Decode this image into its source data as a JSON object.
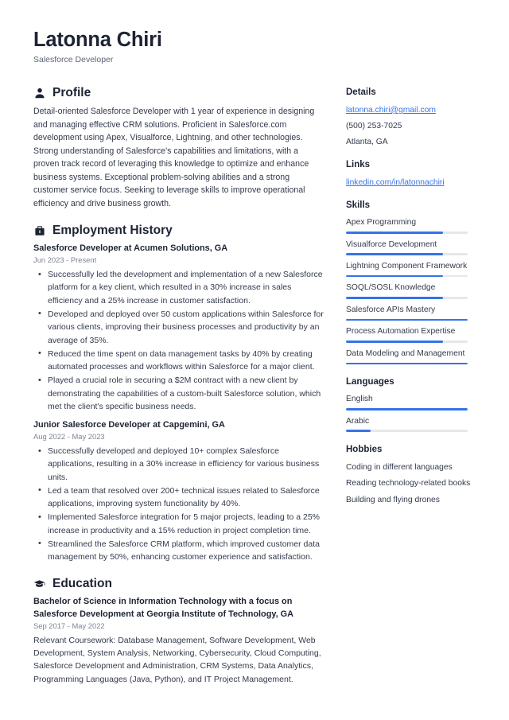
{
  "header": {
    "name": "Latonna Chiri",
    "job_title": "Salesforce Developer"
  },
  "accent_color": "#3574e8",
  "main": {
    "profile": {
      "icon": "person-icon",
      "title": "Profile",
      "text": "Detail-oriented Salesforce Developer with 1 year of experience in designing and managing effective CRM solutions. Proficient in Salesforce.com development using Apex, Visualforce, Lightning, and other technologies. Strong understanding of Salesforce's capabilities and limitations, with a proven track record of leveraging this knowledge to optimize and enhance business systems. Exceptional problem-solving abilities and a strong customer service focus. Seeking to leverage skills to improve operational efficiency and drive business growth."
    },
    "employment": {
      "icon": "briefcase-icon",
      "title": "Employment History",
      "entries": [
        {
          "title": "Salesforce Developer at Acumen Solutions, GA",
          "date": "Jun 2023 - Present",
          "bullets": [
            "Successfully led the development and implementation of a new Salesforce platform for a key client, which resulted in a 30% increase in sales efficiency and a 25% increase in customer satisfaction.",
            "Developed and deployed over 50 custom applications within Salesforce for various clients, improving their business processes and productivity by an average of 35%.",
            "Reduced the time spent on data management tasks by 40% by creating automated processes and workflows within Salesforce for a major client.",
            "Played a crucial role in securing a $2M contract with a new client by demonstrating the capabilities of a custom-built Salesforce solution, which met the client's specific business needs."
          ]
        },
        {
          "title": "Junior Salesforce Developer at Capgemini, GA",
          "date": "Aug 2022 - May 2023",
          "bullets": [
            "Successfully developed and deployed 10+ complex Salesforce applications, resulting in a 30% increase in efficiency for various business units.",
            "Led a team that resolved over 200+ technical issues related to Salesforce applications, improving system functionality by 40%.",
            "Implemented Salesforce integration for 5 major projects, leading to a 25% increase in productivity and a 15% reduction in project completion time.",
            "Streamlined the Salesforce CRM platform, which improved customer data management by 50%, enhancing customer experience and satisfaction."
          ]
        }
      ]
    },
    "education": {
      "icon": "graduation-cap-icon",
      "title": "Education",
      "entries": [
        {
          "title": "Bachelor of Science in Information Technology with a focus on Salesforce Development at Georgia Institute of Technology, GA",
          "date": "Sep 2017 - May 2022",
          "description": "Relevant Coursework: Database Management, Software Development, Web Development, System Analysis, Networking, Cybersecurity, Cloud Computing, Salesforce Development and Administration, CRM Systems, Data Analytics, Programming Languages (Java, Python), and IT Project Management."
        }
      ]
    }
  },
  "sidebar": {
    "details": {
      "title": "Details",
      "email": "latonna.chiri@gmail.com",
      "phone": "(500) 253-7025",
      "location": "Atlanta, GA"
    },
    "links": {
      "title": "Links",
      "items": [
        {
          "label": "linkedin.com/in/latonnachiri"
        }
      ]
    },
    "skills": {
      "title": "Skills",
      "items": [
        {
          "label": "Apex Programming",
          "level": 80
        },
        {
          "label": "Visualforce Development",
          "level": 80
        },
        {
          "label": "Lightning Component Framework",
          "level": 80
        },
        {
          "label": "SOQL/SOSL Knowledge",
          "level": 80
        },
        {
          "label": "Salesforce APIs Mastery",
          "level": 100
        },
        {
          "label": "Process Automation Expertise",
          "level": 80
        },
        {
          "label": "Data Modeling and Management",
          "level": 100
        }
      ]
    },
    "languages": {
      "title": "Languages",
      "items": [
        {
          "label": "English",
          "level": 100
        },
        {
          "label": "Arabic",
          "level": 20
        }
      ]
    },
    "hobbies": {
      "title": "Hobbies",
      "items": [
        {
          "label": "Coding in different languages"
        },
        {
          "label": "Reading technology-related books"
        },
        {
          "label": "Building and flying drones"
        }
      ]
    }
  }
}
